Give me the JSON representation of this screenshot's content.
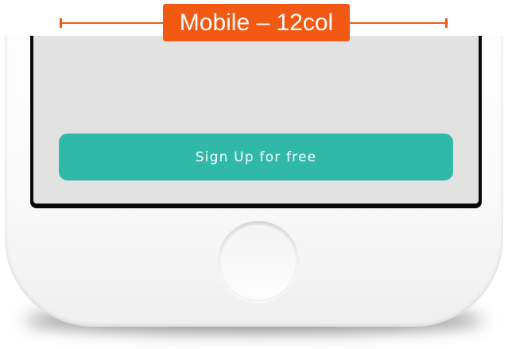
{
  "annotation": {
    "label": "Mobile – 12col",
    "color": "#f25a14"
  },
  "screen": {
    "signup_button": {
      "label": "Sign Up for free",
      "color": "#30b9a9"
    },
    "background": "#e2e2e2"
  },
  "device": {
    "home_button_icon": "home-button-circle"
  }
}
